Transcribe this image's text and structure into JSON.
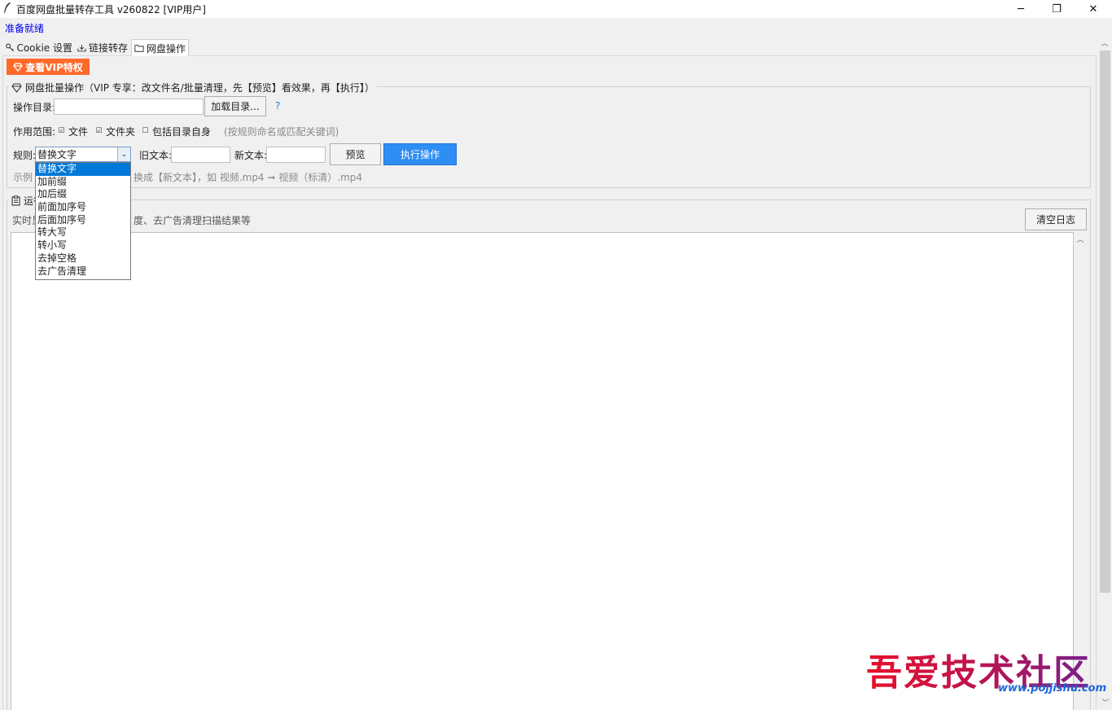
{
  "window": {
    "title": "百度网盘批量转存工具 v260822  [VIP用户]",
    "minimize_glyph": "─",
    "restore_glyph": "❐",
    "close_glyph": "✕"
  },
  "status_text": "准备就绪",
  "tabs": [
    {
      "label": "Cookie 设置",
      "icon": "key-icon",
      "active": false
    },
    {
      "label": "链接转存",
      "icon": "transfer-icon",
      "active": false
    },
    {
      "label": "网盘操作",
      "icon": "folder-icon",
      "active": true
    }
  ],
  "vip_button_label": "查看VIP特权",
  "batch_group": {
    "title": "网盘批量操作（VIP 专享：改文件名/批量清理，先【预览】看效果，再【执行】）",
    "dir_label": "操作目录:",
    "dir_value": "",
    "load_dir_button": "加载目录...",
    "help_glyph": "?",
    "scope_label": "作用范围:",
    "scope_options": [
      {
        "label": "文件",
        "checked": true
      },
      {
        "label": "文件夹",
        "checked": true
      },
      {
        "label": "包括目录自身",
        "checked": false
      }
    ],
    "scope_hint": "(按规则命名或匹配关键词)",
    "rule_label": "规则:",
    "rule_selected": "替换文字",
    "rule_options": [
      "替换文字",
      "加前缀",
      "加后缀",
      "前面加序号",
      "后面加序号",
      "转大写",
      "转小写",
      "去掉空格",
      "去广告清理"
    ],
    "old_text_label": "旧文本:",
    "old_text_value": "",
    "new_text_label": "新文本:",
    "new_text_value": "",
    "preview_button": "预览",
    "execute_button": "执行操作",
    "example_prefix": "示例",
    "example_text": "换成【新文本】，如 视频.mp4 ➞ 视频（标清）.mp4"
  },
  "log_group": {
    "title": "运行",
    "hint_prefix": "实时显",
    "hint_text": "度、去广告清理扫描结果等",
    "clear_button": "清空日志",
    "content": ""
  },
  "watermark": {
    "text": "吾爱技术社区",
    "url": "www.pojjishu.com"
  },
  "colors": {
    "vip_orange": "#ff6a2b",
    "primary_blue": "#2f8ef4",
    "status_blue": "#0000ee",
    "selection_blue": "#0078d7"
  }
}
